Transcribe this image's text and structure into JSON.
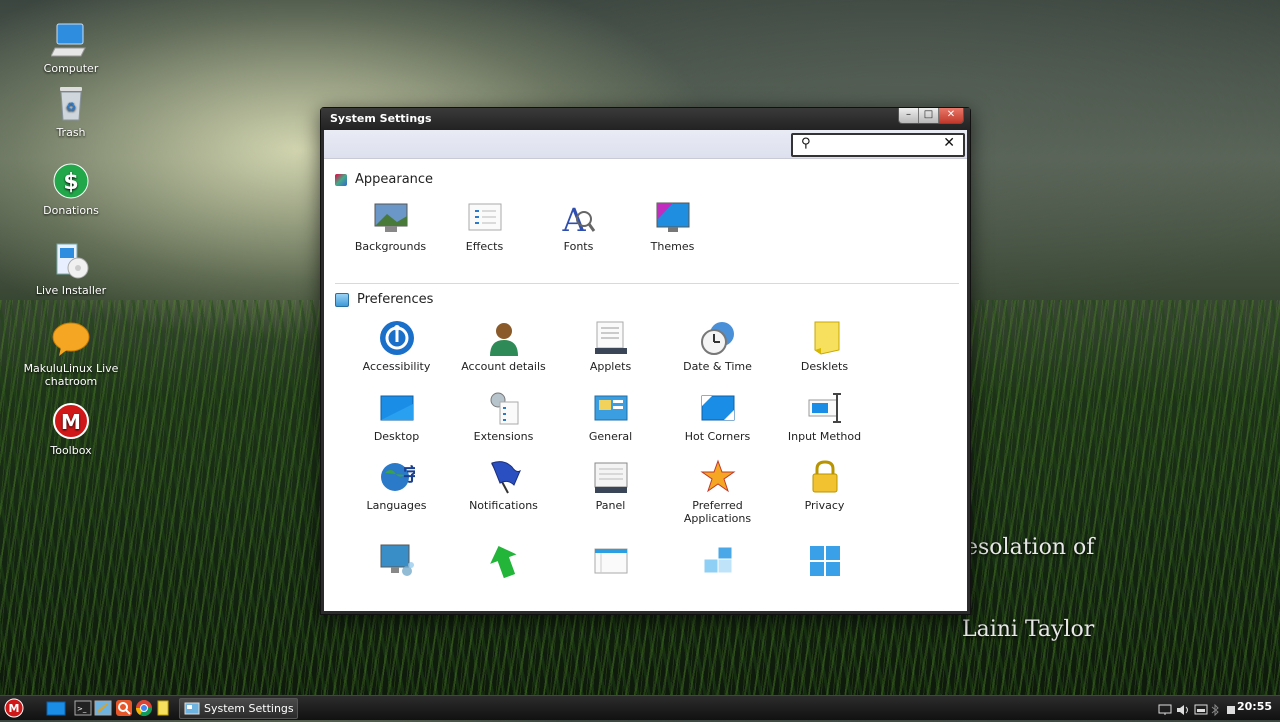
{
  "desktop": {
    "icons": [
      {
        "label": "Computer",
        "icon": "computer-icon"
      },
      {
        "label": "Trash",
        "icon": "trash-icon"
      },
      {
        "label": "Donations",
        "icon": "dollar-icon"
      },
      {
        "label": "Live Installer",
        "icon": "installer-icon"
      },
      {
        "label": "MakuluLinux Live chatroom",
        "icon": "chat-bubble-icon"
      },
      {
        "label": "Toolbox",
        "icon": "makulu-logo-icon"
      }
    ],
    "quote_line1": "esolation of",
    "quote_line2": "Laini Taylor"
  },
  "window": {
    "title": "System Settings",
    "controls": {
      "minimize": "–",
      "maximize": "□",
      "close": "✕"
    },
    "search": {
      "placeholder": "",
      "value": "",
      "search_glyph": "⚲",
      "clear_glyph": "✕"
    },
    "sections": [
      {
        "title": "Appearance",
        "items": [
          "Backgrounds",
          "Effects",
          "Fonts",
          "Themes"
        ]
      },
      {
        "title": "Preferences",
        "items": [
          "Accessibility",
          "Account details",
          "Applets",
          "Date & Time",
          "Desklets",
          "Desktop",
          "Extensions",
          "General",
          "Hot Corners",
          "Input Method",
          "Languages",
          "Notifications",
          "Panel",
          "Preferred Applications",
          "Privacy",
          "",
          "",
          "",
          "",
          ""
        ]
      }
    ]
  },
  "taskbar": {
    "active_task": "System Settings",
    "clock": "20:55"
  },
  "colors": {
    "accent": "#1a6fc9",
    "window_frame": "#2b2b2b",
    "search_bar_bg": "#e3e5f1",
    "close_button": "#c0392b"
  }
}
